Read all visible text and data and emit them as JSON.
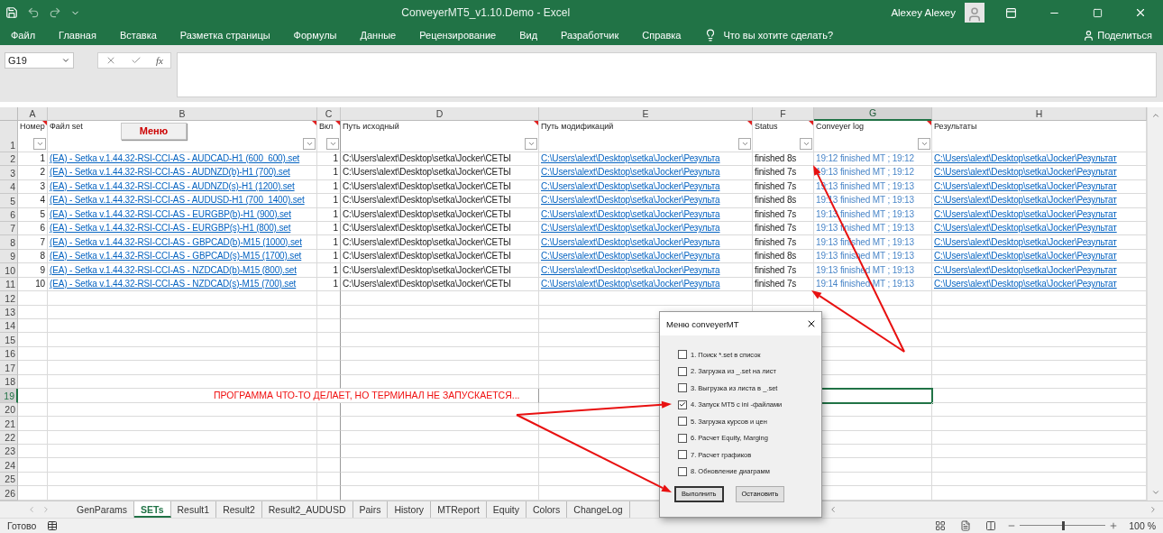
{
  "window": {
    "title": "ConveyerMT5_v1.10.Demo  -  Excel",
    "user": "Alexey Alexey"
  },
  "ribbon": {
    "tabs": [
      "Файл",
      "Главная",
      "Вставка",
      "Разметка страницы",
      "Формулы",
      "Данные",
      "Рецензирование",
      "Вид",
      "Разработчик",
      "Справка"
    ],
    "tell_me": "Что вы хотите сделать?",
    "share": "Поделиться"
  },
  "formula_bar": {
    "name_box": "G19",
    "function_symbol": "fx"
  },
  "sheet": {
    "columns": [
      {
        "letter": "A",
        "header": "Номер",
        "filter": true,
        "comment": true,
        "selected": false
      },
      {
        "letter": "B",
        "header": "Файл set",
        "filter": true,
        "comment": true,
        "selected": false
      },
      {
        "letter": "C",
        "header": "Вкл",
        "filter": true,
        "comment": true,
        "selected": false
      },
      {
        "letter": "D",
        "header": "Путь исходный",
        "filter": true,
        "comment": true,
        "selected": false
      },
      {
        "letter": "E",
        "header": "Путь модификаций",
        "filter": true,
        "comment": true,
        "selected": false
      },
      {
        "letter": "F",
        "header": "Status",
        "filter": true,
        "comment": true,
        "selected": false
      },
      {
        "letter": "G",
        "header": "Conveyer log",
        "filter": true,
        "comment": true,
        "selected": true
      },
      {
        "letter": "H",
        "header": "Результаты",
        "filter": false,
        "comment": false,
        "selected": false
      }
    ],
    "header_row": "1",
    "menu_button": "Меню",
    "data_rows": [
      {
        "row": "2",
        "cells": [
          "1",
          "(EA) - Setka v.1.44.32-RSI-CCI-AS - AUDCAD-H1 (600_600).set",
          "1",
          "C:\\Users\\alext\\Desktop\\setka\\Jocker\\СЕТЫ",
          "C:\\Users\\alext\\Desktop\\setka\\Jocker\\Результа",
          "finished 8s",
          "19:12 finished MT ; 19:12",
          "C:\\Users\\alext\\Desktop\\setka\\Jocker\\Результат"
        ]
      },
      {
        "row": "3",
        "cells": [
          "2",
          "(EA) - Setka v.1.44.32-RSI-CCI-AS - AUDNZD(b)-H1 (700).set",
          "1",
          "C:\\Users\\alext\\Desktop\\setka\\Jocker\\СЕТЫ",
          "C:\\Users\\alext\\Desktop\\setka\\Jocker\\Результа",
          "finished 7s",
          "19:13 finished MT ; 19:12",
          "C:\\Users\\alext\\Desktop\\setka\\Jocker\\Результат"
        ]
      },
      {
        "row": "4",
        "cells": [
          "3",
          "(EA) - Setka v.1.44.32-RSI-CCI-AS - AUDNZD(s)-H1 (1200).set",
          "1",
          "C:\\Users\\alext\\Desktop\\setka\\Jocker\\СЕТЫ",
          "C:\\Users\\alext\\Desktop\\setka\\Jocker\\Результа",
          "finished 7s",
          "19:13 finished MT ; 19:13",
          "C:\\Users\\alext\\Desktop\\setka\\Jocker\\Результат"
        ]
      },
      {
        "row": "5",
        "cells": [
          "4",
          "(EA) - Setka v.1.44.32-RSI-CCI-AS - AUDUSD-H1 (700_1400).set",
          "1",
          "C:\\Users\\alext\\Desktop\\setka\\Jocker\\СЕТЫ",
          "C:\\Users\\alext\\Desktop\\setka\\Jocker\\Результа",
          "finished 8s",
          "19:13 finished MT ; 19:13",
          "C:\\Users\\alext\\Desktop\\setka\\Jocker\\Результат"
        ]
      },
      {
        "row": "6",
        "cells": [
          "5",
          "(EA) - Setka v.1.44.32-RSI-CCI-AS - EURGBP(b)-H1 (900).set",
          "1",
          "C:\\Users\\alext\\Desktop\\setka\\Jocker\\СЕТЫ",
          "C:\\Users\\alext\\Desktop\\setka\\Jocker\\Результа",
          "finished 7s",
          "19:13 finished MT ; 19:13",
          "C:\\Users\\alext\\Desktop\\setka\\Jocker\\Результат"
        ]
      },
      {
        "row": "7",
        "cells": [
          "6",
          "(EA) - Setka v.1.44.32-RSI-CCI-AS - EURGBP(s)-H1 (800).set",
          "1",
          "C:\\Users\\alext\\Desktop\\setka\\Jocker\\СЕТЫ",
          "C:\\Users\\alext\\Desktop\\setka\\Jocker\\Результа",
          "finished 7s",
          "19:13 finished MT ; 19:13",
          "C:\\Users\\alext\\Desktop\\setka\\Jocker\\Результат"
        ]
      },
      {
        "row": "8",
        "cells": [
          "7",
          "(EA) - Setka v.1.44.32-RSI-CCI-AS - GBPCAD(b)-M15 (1000).set",
          "1",
          "C:\\Users\\alext\\Desktop\\setka\\Jocker\\СЕТЫ",
          "C:\\Users\\alext\\Desktop\\setka\\Jocker\\Результа",
          "finished 7s",
          "19:13 finished MT ; 19:13",
          "C:\\Users\\alext\\Desktop\\setka\\Jocker\\Результат"
        ]
      },
      {
        "row": "9",
        "cells": [
          "8",
          "(EA) - Setka v.1.44.32-RSI-CCI-AS - GBPCAD(s)-M15 (1700).set",
          "1",
          "C:\\Users\\alext\\Desktop\\setka\\Jocker\\СЕТЫ",
          "C:\\Users\\alext\\Desktop\\setka\\Jocker\\Результа",
          "finished 8s",
          "19:13 finished MT ; 19:13",
          "C:\\Users\\alext\\Desktop\\setka\\Jocker\\Результат"
        ]
      },
      {
        "row": "10",
        "cells": [
          "9",
          "(EA) - Setka v.1.44.32-RSI-CCI-AS - NZDCAD(b)-M15 (800).set",
          "1",
          "C:\\Users\\alext\\Desktop\\setka\\Jocker\\СЕТЫ",
          "C:\\Users\\alext\\Desktop\\setka\\Jocker\\Результа",
          "finished 7s",
          "19:13 finished MT ; 19:13",
          "C:\\Users\\alext\\Desktop\\setka\\Jocker\\Результат"
        ]
      },
      {
        "row": "11",
        "cells": [
          "10",
          "(EA) - Setka v.1.44.32-RSI-CCI-AS - NZDCAD(s)-M15 (700).set",
          "1",
          "C:\\Users\\alext\\Desktop\\setka\\Jocker\\СЕТЫ",
          "C:\\Users\\alext\\Desktop\\setka\\Jocker\\Результа",
          "finished 7s",
          "19:14 finished MT ; 19:13",
          "C:\\Users\\alext\\Desktop\\setka\\Jocker\\Результат"
        ]
      }
    ],
    "empty_rows": [
      {
        "row": "12",
        "selected": false
      },
      {
        "row": "13",
        "selected": false
      },
      {
        "row": "14",
        "selected": false
      },
      {
        "row": "15",
        "selected": false
      },
      {
        "row": "16",
        "selected": false
      },
      {
        "row": "17",
        "selected": false
      },
      {
        "row": "18",
        "selected": false
      },
      {
        "row": "19",
        "selected": true,
        "note": "ПРОГРАММА ЧТО-ТО ДЕЛАЕТ, НО ТЕРМИНАЛ НЕ ЗАПУСКАЕТСЯ..."
      },
      {
        "row": "20",
        "selected": false
      },
      {
        "row": "21",
        "selected": false
      },
      {
        "row": "22",
        "selected": false
      },
      {
        "row": "23",
        "selected": false
      },
      {
        "row": "24",
        "selected": false
      },
      {
        "row": "25",
        "selected": false
      },
      {
        "row": "26",
        "selected": false
      }
    ]
  },
  "dialog": {
    "title": "Меню conveyerMT",
    "options": [
      {
        "label": "1. Поиск *.set в список",
        "checked": false
      },
      {
        "label": "2. Загрузка из _.set на лист",
        "checked": false
      },
      {
        "label": "3. Выгрузка из листа в _.set",
        "checked": false
      },
      {
        "label": "4. Запуск MT5 с ini -файлами",
        "checked": true
      },
      {
        "label": "5. Загрузка курсов и цен",
        "checked": false
      },
      {
        "label": "6. Расчет Equity, Marging",
        "checked": false
      },
      {
        "label": "7. Расчет графиков",
        "checked": false
      },
      {
        "label": "8. Обновление диаграмм",
        "checked": false
      }
    ],
    "buttons": [
      {
        "label": "Выполнить",
        "default": true
      },
      {
        "label": "Остановить",
        "default": false
      }
    ]
  },
  "sheet_tabs": [
    {
      "label": "GenParams",
      "selected": false
    },
    {
      "label": "SETs",
      "selected": true
    },
    {
      "label": "Result1",
      "selected": false
    },
    {
      "label": "Result2",
      "selected": false
    },
    {
      "label": "Result2_AUDUSD",
      "selected": false
    },
    {
      "label": "Pairs",
      "selected": false
    },
    {
      "label": "History",
      "selected": false
    },
    {
      "label": "MTReport",
      "selected": false
    },
    {
      "label": "Equity",
      "selected": false
    },
    {
      "label": "Colors",
      "selected": false
    },
    {
      "label": "ChangeLog",
      "selected": false
    }
  ],
  "status_bar": {
    "status": "Готово",
    "zoom": "100 %",
    "level": 0.5
  }
}
